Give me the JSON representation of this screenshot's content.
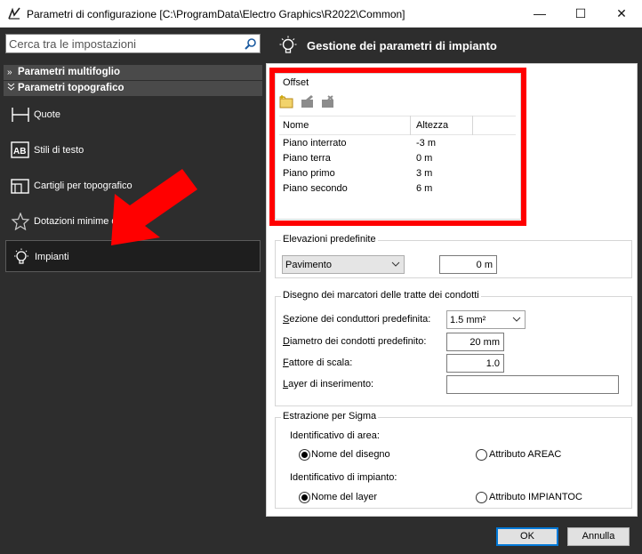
{
  "window": {
    "title": "Parametri di configurazione [C:\\ProgramData\\Electro Graphics\\R2022\\Common]",
    "minimize": "—",
    "maximize": "☐",
    "close": "✕"
  },
  "sidebar": {
    "search_placeholder": "Cerca tra le impostazioni",
    "groups": [
      {
        "label": "Parametri multifoglio",
        "chevron": "»"
      },
      {
        "label": "Parametri topografico",
        "chevron": "¥"
      }
    ],
    "items": [
      {
        "label": "Quote",
        "icon": "dimension-icon"
      },
      {
        "label": "Stili di testo",
        "icon": "text-style-icon"
      },
      {
        "label": "Cartigli per topografico",
        "icon": "title-block-icon"
      },
      {
        "label": "Dotazioni minime d'im",
        "icon": "star-icon"
      },
      {
        "label": "Impianti",
        "icon": "lightbulb-icon",
        "selected": true
      }
    ]
  },
  "panel": {
    "title": "Gestione dei parametri di impianto"
  },
  "offset": {
    "title": "Offset",
    "columns": [
      "Nome",
      "Altezza"
    ],
    "rows": [
      {
        "name": "Piano interrato",
        "height": "-3 m"
      },
      {
        "name": "Piano terra",
        "height": "0 m"
      },
      {
        "name": "Piano primo",
        "height": "3 m"
      },
      {
        "name": "Piano secondo",
        "height": "6 m"
      }
    ]
  },
  "elevations": {
    "title": "Elevazioni predefinite",
    "combo_value": "Pavimento",
    "value": "0 m"
  },
  "markers": {
    "title": "Disegno dei marcatori delle tratte dei condotti",
    "section_label_prefix": "S",
    "section_label_rest": "ezione dei conduttori predefinita:",
    "section_value": "1.5 mm²",
    "diameter_label_prefix": "D",
    "diameter_label_rest": "iametro dei condotti predefinito:",
    "diameter_value": "20 mm",
    "scale_label_prefix": "F",
    "scale_label_rest": "attore di scala:",
    "scale_value": "1.0",
    "layer_label_prefix": "L",
    "layer_label_rest": "ayer di inserimento:",
    "layer_value": ""
  },
  "sigma": {
    "title": "Estrazione per Sigma",
    "area_label": "Identificativo di area:",
    "area_opt1": "Nome del disegno",
    "area_opt2": "Attributo AREAC",
    "plant_label": "Identificativo di impianto:",
    "plant_opt1": "Nome del layer",
    "plant_opt2": "Attributo IMPIANTOC"
  },
  "buttons": {
    "ok": "OK",
    "cancel": "Annulla"
  },
  "colors": {
    "dark_panel": "#2d2d2d",
    "highlight_red": "#ff0000",
    "ok_border": "#0078d7"
  }
}
